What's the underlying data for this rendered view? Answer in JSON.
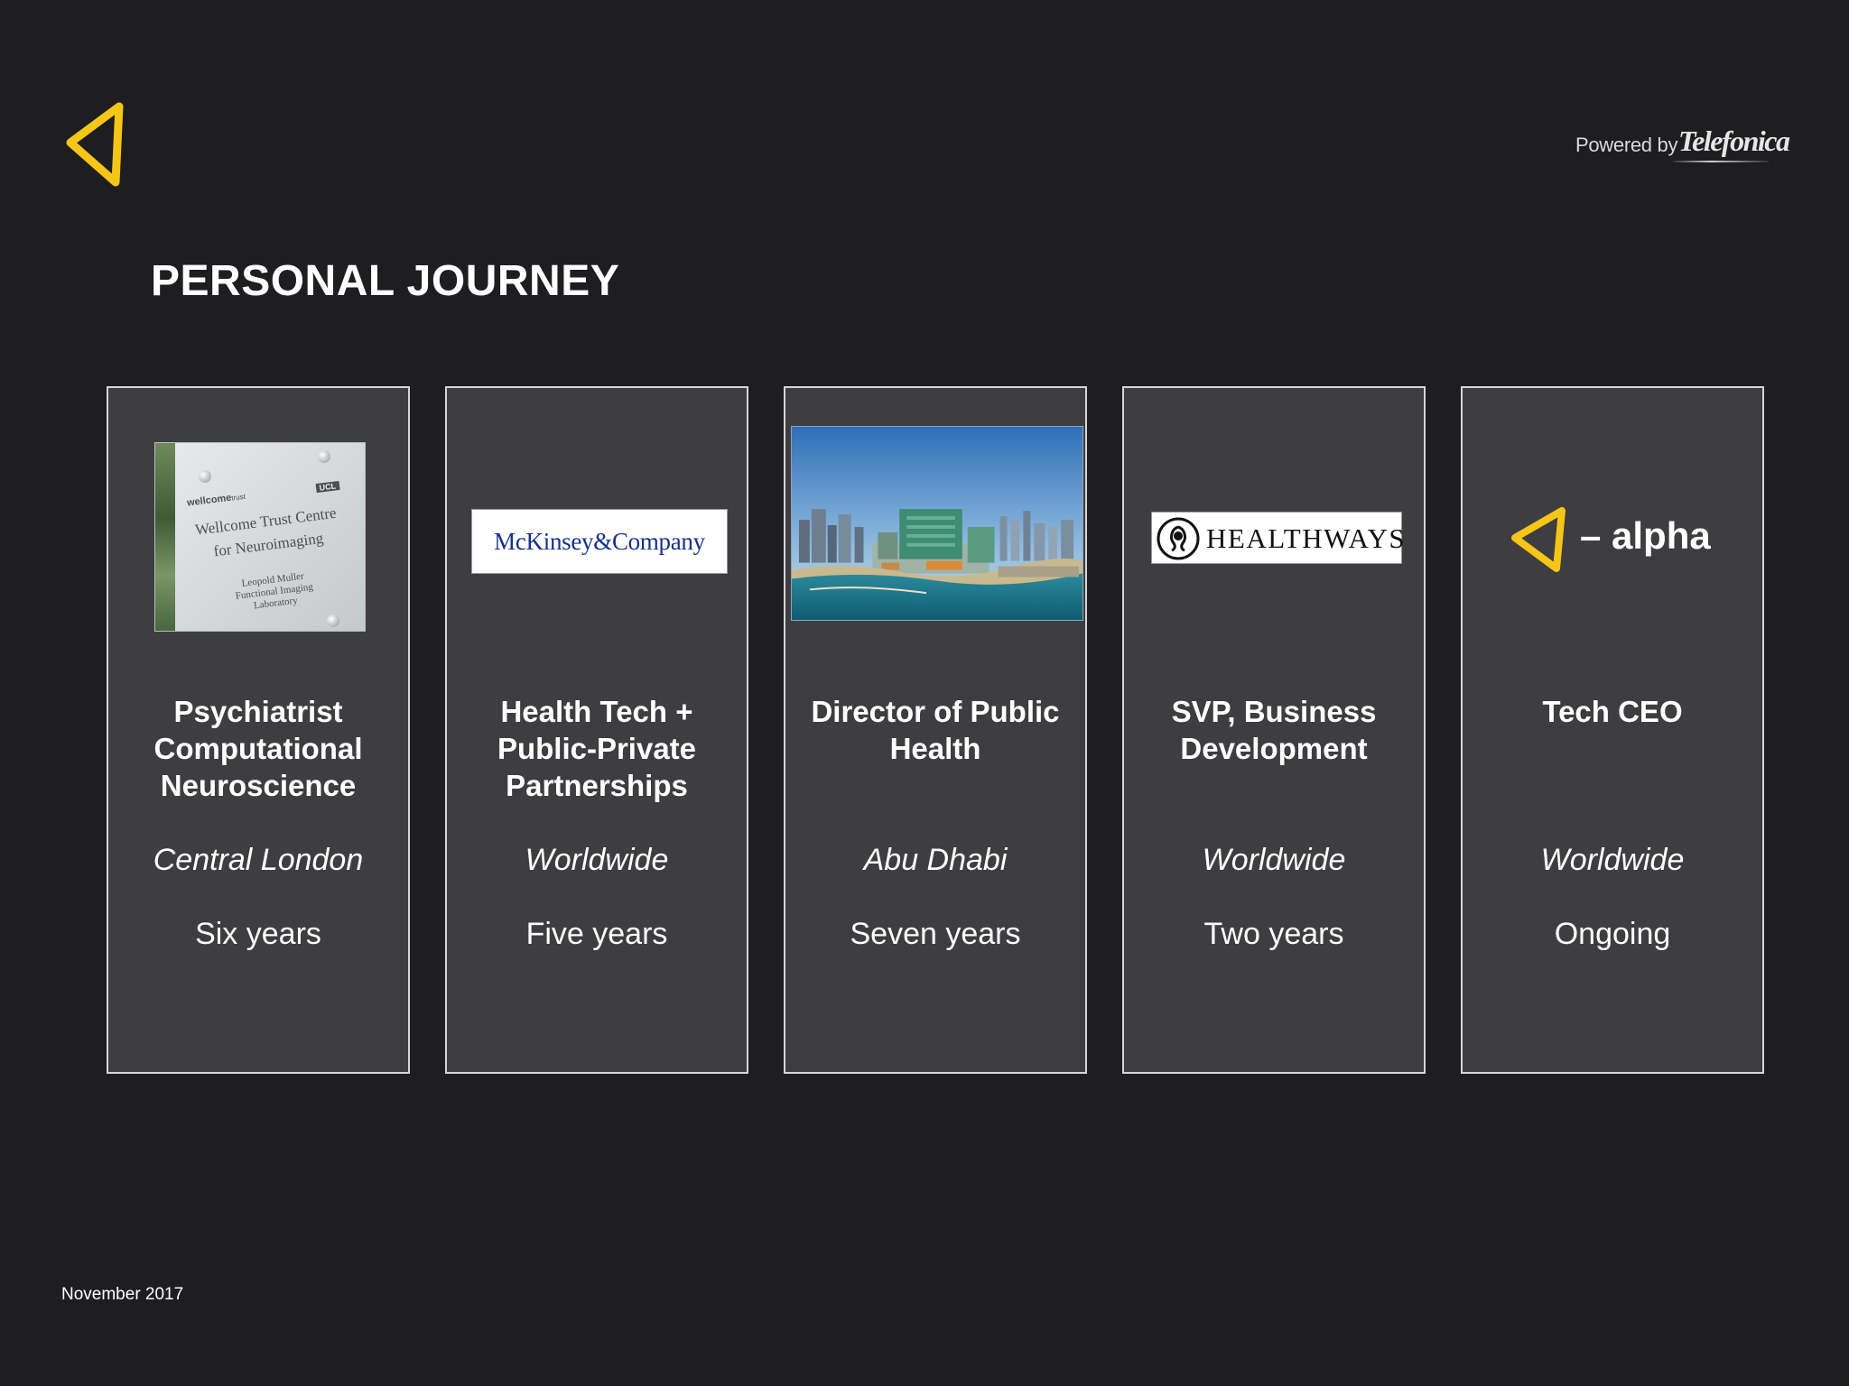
{
  "header": {
    "powered_prefix": "Powered by",
    "powered_brand": "Telefonica"
  },
  "page_title": "PERSONAL JOURNEY",
  "colors": {
    "background": "#1e1e20",
    "card": "#3e3d40",
    "card_border": "#d6d6d6",
    "accent": "#f5c518"
  },
  "cards": [
    {
      "image": "wellcome-trust-sign-photo",
      "image_text": {
        "brand": "wellcome",
        "brand_suffix": "trust",
        "tag": "UCL",
        "line1": "Wellcome Trust Centre",
        "line2": "for Neuroimaging",
        "sub1": "Leopold Muller",
        "sub2": "Functional Imaging",
        "sub3": "Laboratory"
      },
      "role_lines": [
        "Psychiatrist",
        "Computational",
        "Neuroscience"
      ],
      "location": "Central London",
      "duration": "Six years"
    },
    {
      "image": "mckinsey-logo",
      "logo_text": "McKinsey&Company",
      "role_lines": [
        "Health Tech +",
        "Public-Private",
        "Partnerships"
      ],
      "location": "Worldwide",
      "duration": "Five years"
    },
    {
      "image": "abu-dhabi-city-photo",
      "role_lines": [
        "Director of Public",
        "Health"
      ],
      "location": "Abu Dhabi",
      "duration": "Seven years"
    },
    {
      "image": "healthways-logo",
      "logo_text": "HEALTHWAYS",
      "role_lines": [
        "SVP, Business",
        "Development"
      ],
      "location": "Worldwide",
      "duration": "Two years"
    },
    {
      "image": "alpha-logo",
      "logo_text": "– alpha",
      "role_lines": [
        "Tech CEO"
      ],
      "location": "Worldwide",
      "duration": "Ongoing"
    }
  ],
  "footer": {
    "date": "November 2017"
  }
}
